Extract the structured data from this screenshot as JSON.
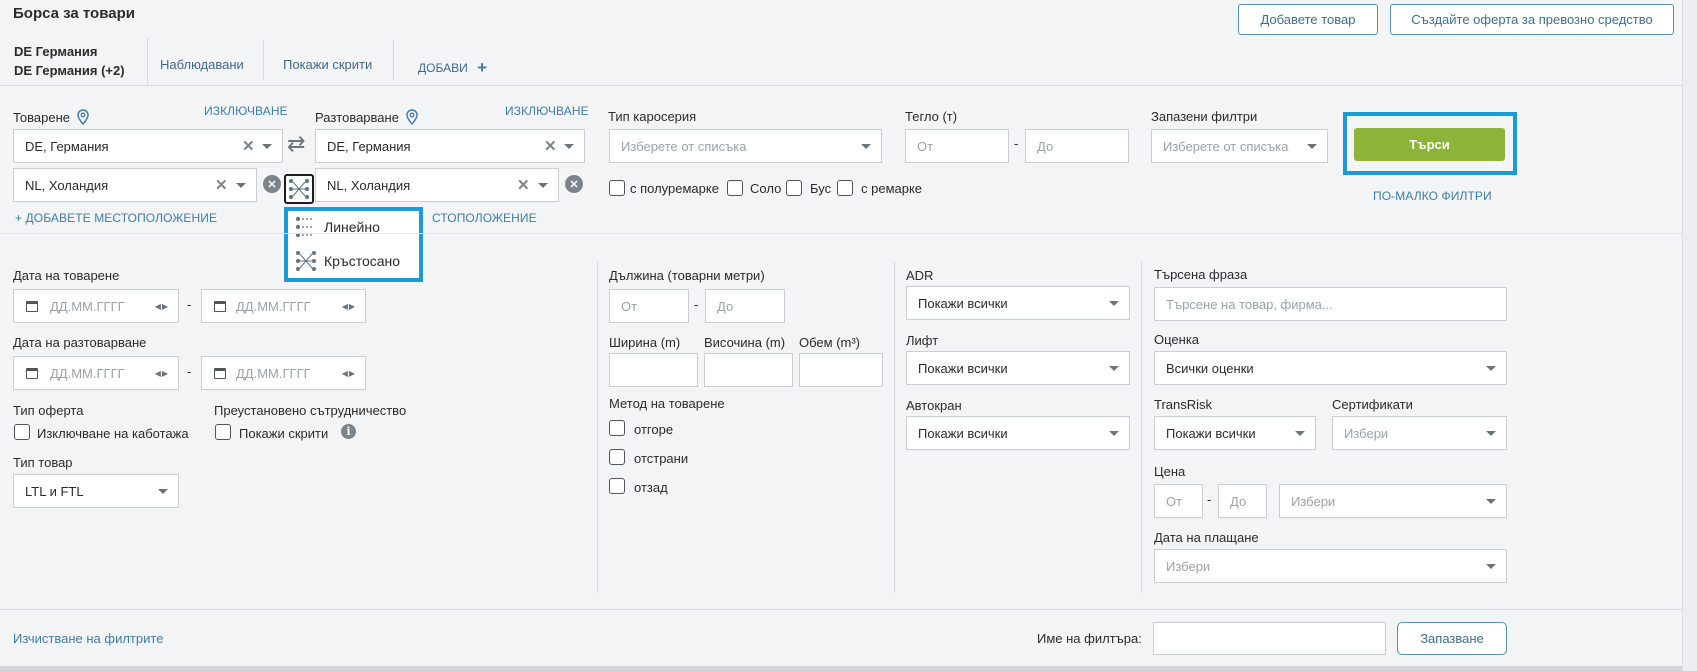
{
  "header": {
    "title": "Борса за товари",
    "add_cargo_button": "Добавете товар",
    "create_vehicle_offer_button": "Създайте оферта за превозно средство"
  },
  "tabs": {
    "active_line1": "DE Германия",
    "active_line2": "DE Германия (+2)",
    "watched": "Наблюдавани",
    "show_hidden": "Покажи скрити",
    "add": "ДОБАВИ"
  },
  "loading": {
    "label": "Товарене",
    "exclude": "ИЗКЛЮЧВАНЕ",
    "location1": "DE,  Германия",
    "location2": "NL,  Холандия",
    "add_location": "+ ДОБАВЕТЕ МЕСТОПОЛОЖЕНИЕ"
  },
  "unloading": {
    "label": "Разтоварване",
    "exclude": "ИЗКЛЮЧВАНЕ",
    "location1": "DE,  Германия",
    "location2": "NL,  Холандия",
    "add_location_partial": "СТОПОЛОЖЕНИЕ"
  },
  "route_menu": {
    "linear": "Линейно",
    "crossed": "Кръстосано"
  },
  "body_type": {
    "label": "Тип каросерия",
    "placeholder": "Изберете от списъка",
    "semitrailer": "с полуремарке",
    "solo": "Соло",
    "bus": "Бус",
    "trailer": "с ремарке"
  },
  "weight": {
    "label": "Тегло (т)",
    "from": "От",
    "to": "До",
    "dash": "-"
  },
  "saved_filters": {
    "label": "Запазени филтри",
    "placeholder": "Изберете от списъка"
  },
  "search": {
    "button": "Търси",
    "fewer_filters": "ПО-МАЛКО ФИЛТРИ"
  },
  "dates": {
    "loading_label": "Дата на товарене",
    "unloading_label": "Дата на разтоварване",
    "placeholder": "ДД.ММ.ГГГГ",
    "dash": "-"
  },
  "offer_type": {
    "label": "Тип оферта",
    "exclude_cabotage": "Изключване на каботажа"
  },
  "suspended": {
    "label": "Преустановено сътрудничество",
    "show_hidden": "Покажи скрити"
  },
  "cargo_type": {
    "label": "Тип товар",
    "value": "LTL и FTL"
  },
  "length": {
    "label": "Дължина (товарни метри)",
    "from": "От",
    "to": "До"
  },
  "dims": {
    "width": "Ширина (m)",
    "height": "Височина (m)",
    "volume": "Обем (m³)"
  },
  "loading_method": {
    "label": "Метод на товарене",
    "top": "отгоре",
    "side": "отстрани",
    "back": "отзад"
  },
  "adr": {
    "label": "ADR",
    "value": "Покажи всички"
  },
  "lift": {
    "label": "Лифт",
    "value": "Покажи всички"
  },
  "crane": {
    "label": "Автокран",
    "value": "Покажи всички"
  },
  "phrase": {
    "label": "Търсена фраза",
    "placeholder": "Търсене на товар, фирма..."
  },
  "rating": {
    "label": "Оценка",
    "value": "Всички оценки"
  },
  "transrisk": {
    "label": "TransRisk",
    "value": "Покажи всички"
  },
  "certificates": {
    "label": "Сертификати",
    "placeholder": "Избери"
  },
  "price": {
    "label": "Цена",
    "from": "От",
    "to": "До",
    "currency_placeholder": "Избери"
  },
  "payment_date": {
    "label": "Дата на плащане",
    "placeholder": "Избери"
  },
  "footer": {
    "clear_filters": "Изчистване на филтрите",
    "filter_name_label": "Име на филтъра:",
    "save_button": "Запазване"
  },
  "colors": {
    "accent_green": "#8db33a",
    "highlight_blue": "#1a9bd7",
    "link_blue": "#3f7ea6"
  }
}
